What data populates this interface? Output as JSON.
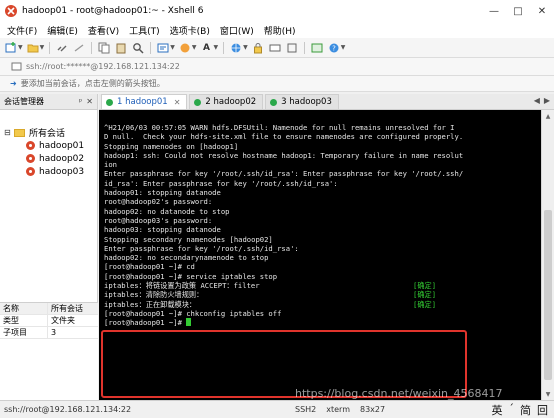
{
  "window": {
    "title": "hadoop01 - root@hadoop01:~ - Xshell 6",
    "minimize": "—",
    "maximize": "□",
    "close": "✕"
  },
  "menu": [
    "文件(F)",
    "编辑(E)",
    "查看(V)",
    "工具(T)",
    "选项卡(B)",
    "窗口(W)",
    "帮助(H)"
  ],
  "address": {
    "placeholder": "ssh://root:******@192.168.121.134:22"
  },
  "hint": {
    "text": "要添加当前会话，点击左侧的箭头按钮。"
  },
  "session_panel": {
    "title": "会话管理器",
    "pin": "ᵖ",
    "close": "✕",
    "root": "所有会话",
    "hosts": [
      "hadoop01",
      "hadoop02",
      "hadoop03"
    ]
  },
  "properties": {
    "header": [
      "名称",
      "所有会话"
    ],
    "rows": [
      [
        "类型",
        "文件夹"
      ],
      [
        "子项目",
        "3"
      ]
    ]
  },
  "tabs": [
    {
      "label": "1 hadoop01",
      "color": "#2aa84a"
    },
    {
      "label": "2 hadoop02",
      "color": "#2aa84a"
    },
    {
      "label": "3 hadoop03",
      "color": "#2aa84a"
    }
  ],
  "terminal": {
    "lines": [
      "^H21/06/03 00:57:05 WARN hdfs.DFSUtil: Namenode for null remains unresolved for I",
      "D null.  Check your hdfs-site.xml file to ensure namenodes are configured properly.",
      "Stopping namenodes on [hadoop1]",
      "hadoop1: ssh: Could not resolve hostname hadoop1: Temporary failure in name resolut",
      "ion",
      "Enter passphrase for key '/root/.ssh/id_rsa': Enter passphrase for key '/root/.ssh/",
      "id_rsa': Enter passphrase for key '/root/.ssh/id_rsa':",
      "hadoop01: stopping datanode",
      "",
      "",
      "root@hadoop02's password:",
      "hadoop02: no datanode to stop",
      "",
      "",
      "root@hadoop03's password:",
      "hadoop03: stopping datanode",
      "Stopping secondary namenodes [hadoop02]",
      "Enter passphrase for key '/root/.ssh/id_rsa':",
      "hadoop02: no secondarynamenode to stop",
      "[root@hadoop01 ~]# cd",
      "[root@hadoop01 ~]# service iptables stop"
    ],
    "iptables": [
      {
        "text": "iptables：将链设置为政策 ACCEPT：filter",
        "status": "[确定]"
      },
      {
        "text": "iptables：清除防火墙规则：",
        "status": "[确定]"
      },
      {
        "text": "iptables：正在卸载模块：",
        "status": "[确定]"
      }
    ],
    "after": "[root@hadoop01 ~]# chkconfig iptables off",
    "prompt": "[root@hadoop01 ~]# "
  },
  "watermark": "https://blog.csdn.net/weixin_4568417",
  "status": {
    "connection": "ssh://root@192.168.121.134:22",
    "protocol": "SSH2",
    "terminal_type": "xterm",
    "size": "83x27",
    "ime": [
      "英",
      "ˊ",
      "简",
      "回"
    ]
  }
}
